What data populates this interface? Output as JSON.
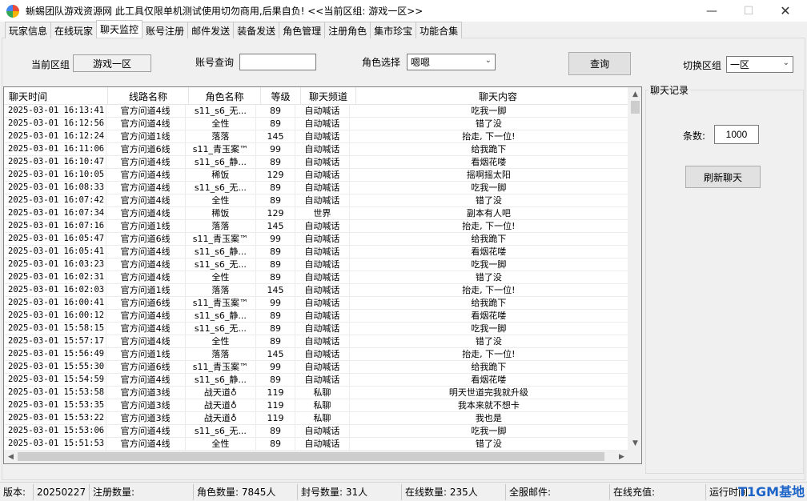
{
  "window": {
    "title": "蜥蜴团队游戏资源网 此工具仅限单机测试使用切勿商用,后果自负! <<当前区组: 游戏一区>>",
    "min_icon": "minimize-icon",
    "max_icon": "maximize-icon",
    "close_icon": "close-icon"
  },
  "tabs": [
    {
      "label": "玩家信息"
    },
    {
      "label": "在线玩家"
    },
    {
      "label": "聊天监控"
    },
    {
      "label": "账号注册"
    },
    {
      "label": "邮件发送"
    },
    {
      "label": "装备发送"
    },
    {
      "label": "角色管理"
    },
    {
      "label": "注册角色"
    },
    {
      "label": "集市珍宝"
    },
    {
      "label": "功能合集"
    }
  ],
  "active_tab": "聊天监控",
  "filters": {
    "current_group_label": "当前区组",
    "current_group_value": "游戏一区",
    "account_query_label": "账号查询",
    "account_query_value": "",
    "role_select_label": "角色选择",
    "role_select_value": "嗯嗯",
    "query_button": "查询",
    "switch_group_label": "切换区组",
    "switch_group_value": "一区"
  },
  "table": {
    "headers": [
      "聊天时间",
      "线路名称",
      "角色名称",
      "等级",
      "聊天频道",
      "聊天内容"
    ],
    "rows": [
      [
        "2025-03-01 16:13:41",
        "官方问道4线",
        "s11_s6_无...",
        "89",
        "自动喊话",
        "吃我一脚"
      ],
      [
        "2025-03-01 16:12:56",
        "官方问道4线",
        "全性",
        "89",
        "自动喊话",
        "错了没"
      ],
      [
        "2025-03-01 16:12:24",
        "官方问道1线",
        "落落",
        "145",
        "自动喊话",
        "抬走, 下一位!"
      ],
      [
        "2025-03-01 16:11:06",
        "官方问道6线",
        "s11_青玉案™",
        "99",
        "自动喊话",
        "给我跪下"
      ],
      [
        "2025-03-01 16:10:47",
        "官方问道4线",
        "s11_s6_静...",
        "89",
        "自动喊话",
        "看烟花喽"
      ],
      [
        "2025-03-01 16:10:05",
        "官方问道4线",
        "稀饭",
        "129",
        "自动喊话",
        "摇啊摇太阳"
      ],
      [
        "2025-03-01 16:08:33",
        "官方问道4线",
        "s11_s6_无...",
        "89",
        "自动喊话",
        "吃我一脚"
      ],
      [
        "2025-03-01 16:07:42",
        "官方问道4线",
        "全性",
        "89",
        "自动喊话",
        "错了没"
      ],
      [
        "2025-03-01 16:07:34",
        "官方问道4线",
        "稀饭",
        "129",
        "世界",
        "副本有人吧"
      ],
      [
        "2025-03-01 16:07:16",
        "官方问道1线",
        "落落",
        "145",
        "自动喊话",
        "抬走, 下一位!"
      ],
      [
        "2025-03-01 16:05:47",
        "官方问道6线",
        "s11_青玉案™",
        "99",
        "自动喊话",
        "给我跪下"
      ],
      [
        "2025-03-01 16:05:41",
        "官方问道4线",
        "s11_s6_静...",
        "89",
        "自动喊话",
        "看烟花喽"
      ],
      [
        "2025-03-01 16:03:23",
        "官方问道4线",
        "s11_s6_无...",
        "89",
        "自动喊话",
        "吃我一脚"
      ],
      [
        "2025-03-01 16:02:31",
        "官方问道4线",
        "全性",
        "89",
        "自动喊话",
        "错了没"
      ],
      [
        "2025-03-01 16:02:03",
        "官方问道1线",
        "落落",
        "145",
        "自动喊话",
        "抬走, 下一位!"
      ],
      [
        "2025-03-01 16:00:41",
        "官方问道6线",
        "s11_青玉案™",
        "99",
        "自动喊话",
        "给我跪下"
      ],
      [
        "2025-03-01 16:00:12",
        "官方问道4线",
        "s11_s6_静...",
        "89",
        "自动喊话",
        "看烟花喽"
      ],
      [
        "2025-03-01 15:58:15",
        "官方问道4线",
        "s11_s6_无...",
        "89",
        "自动喊话",
        "吃我一脚"
      ],
      [
        "2025-03-01 15:57:17",
        "官方问道4线",
        "全性",
        "89",
        "自动喊话",
        "错了没"
      ],
      [
        "2025-03-01 15:56:49",
        "官方问道1线",
        "落落",
        "145",
        "自动喊话",
        "抬走, 下一位!"
      ],
      [
        "2025-03-01 15:55:30",
        "官方问道6线",
        "s11_青玉案™",
        "99",
        "自动喊话",
        "给我跪下"
      ],
      [
        "2025-03-01 15:54:59",
        "官方问道4线",
        "s11_s6_静...",
        "89",
        "自动喊话",
        "看烟花喽"
      ],
      [
        "2025-03-01 15:53:58",
        "官方问道3线",
        "战天道♁",
        "119",
        "私聊",
        "明天世道完我就升级"
      ],
      [
        "2025-03-01 15:53:35",
        "官方问道3线",
        "战天道♁",
        "119",
        "私聊",
        "我本来就不想卡"
      ],
      [
        "2025-03-01 15:53:22",
        "官方问道3线",
        "战天道♁",
        "119",
        "私聊",
        "我也是"
      ],
      [
        "2025-03-01 15:53:06",
        "官方问道4线",
        "s11_s6_无...",
        "89",
        "自动喊话",
        "吃我一脚"
      ],
      [
        "2025-03-01 15:51:53",
        "官方问道4线",
        "全性",
        "89",
        "自动喊话",
        "错了没"
      ]
    ]
  },
  "chat_record": {
    "title": "聊天记录",
    "count_label": "条数:",
    "count_value": "1000",
    "refresh_button": "刷新聊天"
  },
  "statusbar": {
    "version_label": "版本:",
    "version_value": "20250227",
    "registered_label": "注册数量:",
    "registered_value": "",
    "roles_label": "角色数量:",
    "roles_value": "7845人",
    "banned_label": "封号数量:",
    "banned_value": "31人",
    "online_label": "在线数量:",
    "online_value": "235人",
    "server_mail_label": "全服邮件:",
    "server_mail_value": "",
    "online_recharge_label": "在线充值:",
    "online_recharge_value": "",
    "runtime_label": "运行时间"
  },
  "watermark": "T1GM基地"
}
